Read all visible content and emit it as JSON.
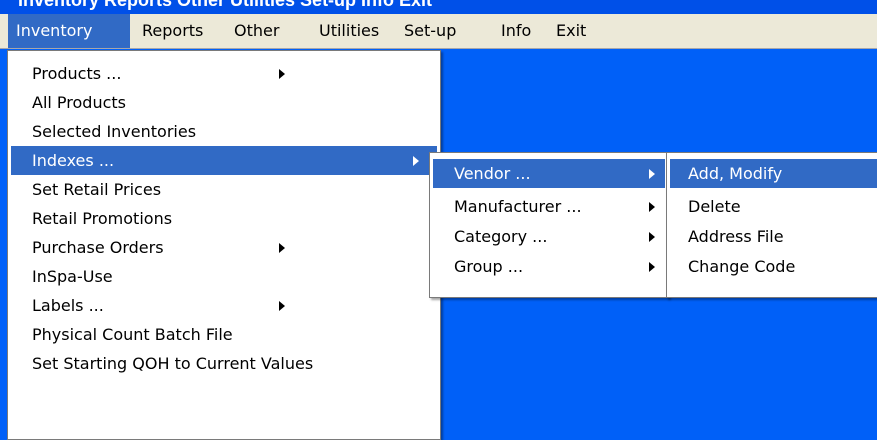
{
  "window": {
    "caption": "Inventory Reports Other Utilities Set-up Info Exit"
  },
  "menubar": {
    "items": [
      {
        "label": "Inventory"
      },
      {
        "label": "Reports"
      },
      {
        "label": "Other"
      },
      {
        "label": "Utilities"
      },
      {
        "label": "Set-up"
      },
      {
        "label": "Info"
      },
      {
        "label": "Exit"
      }
    ]
  },
  "inventory_menu": {
    "items": [
      {
        "label": "Products ...",
        "submenu": true
      },
      {
        "label": "All Products"
      },
      {
        "label": "Selected Inventories"
      },
      {
        "label": "Indexes ...",
        "submenu": true,
        "highlighted": true
      },
      {
        "label": "Set Retail Prices"
      },
      {
        "label": "Retail Promotions"
      },
      {
        "label": "Purchase Orders",
        "submenu": true
      },
      {
        "label": "InSpa-Use"
      },
      {
        "label": "Labels ...",
        "submenu": true
      },
      {
        "label": "Physical Count Batch File"
      },
      {
        "label": "Set Starting QOH to Current Values"
      }
    ]
  },
  "indexes_submenu": {
    "items": [
      {
        "label": "Vendor ...",
        "submenu": true,
        "highlighted": true
      },
      {
        "label": "Manufacturer ...",
        "submenu": true
      },
      {
        "label": "Category ...",
        "submenu": true
      },
      {
        "label": "Group ...",
        "submenu": true
      }
    ]
  },
  "vendor_submenu": {
    "items": [
      {
        "label": "Add, Modify",
        "highlighted": true
      },
      {
        "label": "Delete"
      },
      {
        "label": "Address File"
      },
      {
        "label": "Change Code"
      }
    ]
  },
  "colors": {
    "desktop": "#0060F8",
    "menubar": "#ECE9D8",
    "highlight": "#316AC5",
    "menu_bg": "#FFFFFF"
  }
}
